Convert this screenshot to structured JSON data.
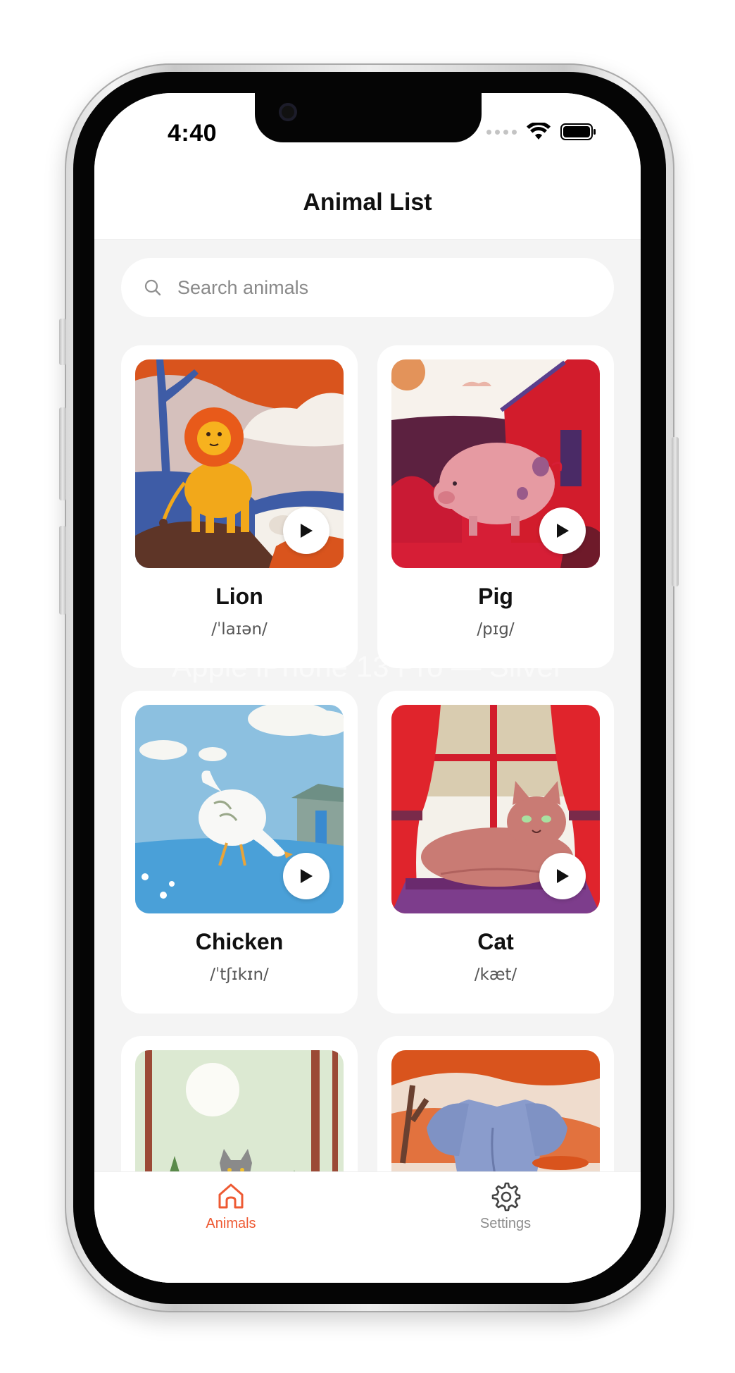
{
  "device": {
    "caption": "Apple iPhone 13 Pro — Silver"
  },
  "status": {
    "time": "4:40"
  },
  "header": {
    "title": "Animal List"
  },
  "search": {
    "placeholder": "Search animals"
  },
  "animals": [
    {
      "name": "Lion",
      "ipa": "/ˈlaɪən/"
    },
    {
      "name": "Pig",
      "ipa": "/pɪɡ/"
    },
    {
      "name": "Chicken",
      "ipa": "/ˈtʃɪkɪn/"
    },
    {
      "name": "Cat",
      "ipa": "/kæt/"
    },
    {
      "name": "",
      "ipa": ""
    },
    {
      "name": "",
      "ipa": ""
    }
  ],
  "tabs": [
    {
      "label": "Animals",
      "icon": "home-icon",
      "active": true
    },
    {
      "label": "Settings",
      "icon": "gear-icon",
      "active": false
    }
  ],
  "colors": {
    "accent": "#ee5a33",
    "background": "#f4f4f4",
    "card": "#ffffff"
  }
}
